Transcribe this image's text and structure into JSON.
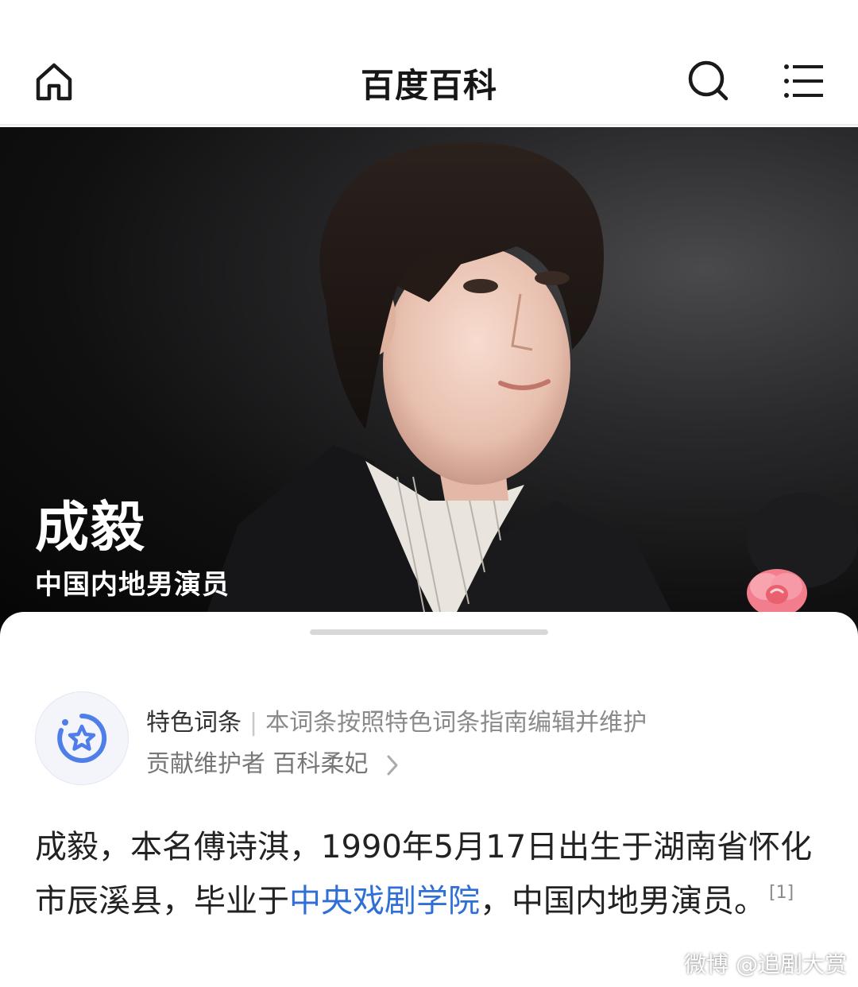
{
  "header": {
    "title": "百度百科",
    "home_icon": "home-icon",
    "search_icon": "search-icon",
    "menu_icon": "menu-icon"
  },
  "hero": {
    "name": "成毅",
    "subtitle": "中国内地男演员"
  },
  "feature": {
    "tag": "特色词条",
    "separator": "|",
    "description": "本词条按照特色词条指南编辑并维护",
    "maintainer_label": "贡献维护者",
    "maintainer_name": "百科柔妃",
    "icon": "star-badge-icon"
  },
  "summary": {
    "part1": "成毅，本名傅诗淇，1990年5月17日出生于湖南省怀化市辰溪县，毕业于",
    "link": "中央戏剧学院",
    "part2": "，中国内地男演员。",
    "ref": "[1]"
  },
  "watermark": "微博 @追剧大赏",
  "colors": {
    "link": "#2f6fd6",
    "muted_text": "#8a8a8a",
    "badge_star": "#4f7ee8"
  }
}
